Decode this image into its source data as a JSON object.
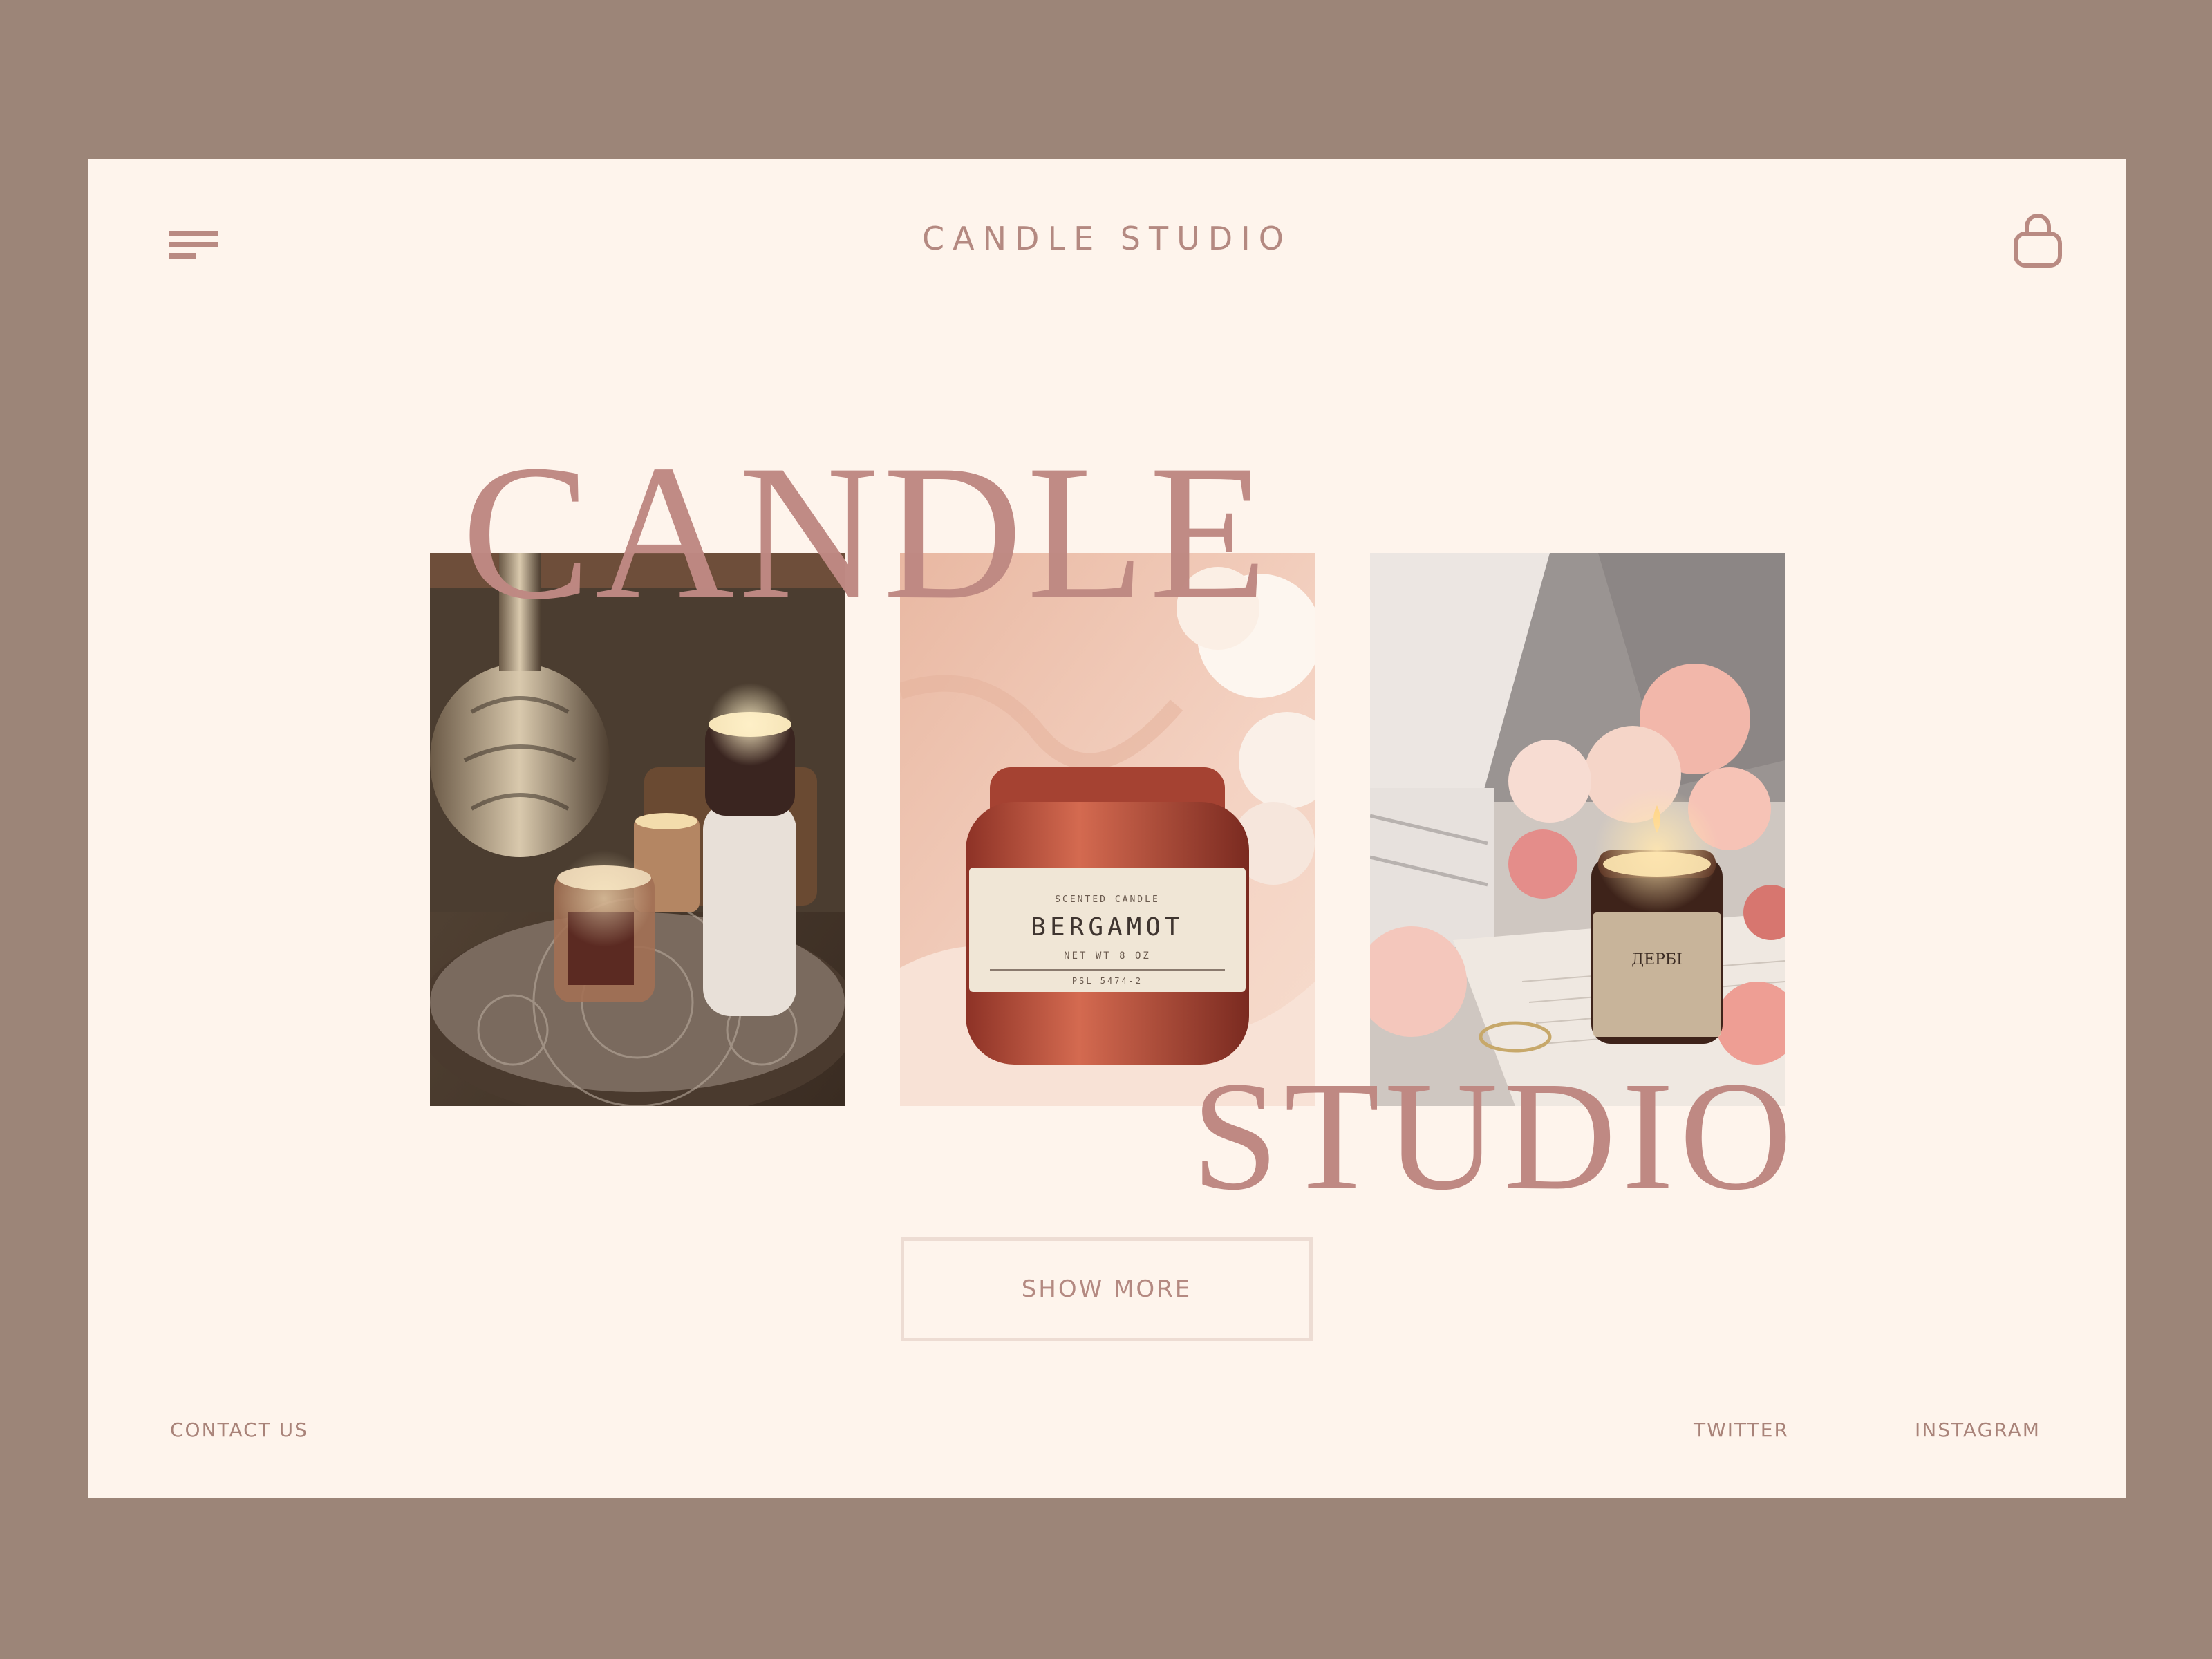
{
  "header": {
    "brand": "CANDLE STUDIO",
    "menu_icon": "menu-icon",
    "bag_icon": "shopping-bag-icon"
  },
  "hero": {
    "title_top": "CANDLE",
    "title_bottom": "STUDIO",
    "photos": [
      {
        "name": "candles-on-tray-photo"
      },
      {
        "name": "bergamot-candle-jar-photo",
        "label_top": "SCENTED CANDLE",
        "label_main": "BERGAMOT",
        "label_sub": "NET WT 8 OZ",
        "label_code": "PSL 5474-2"
      },
      {
        "name": "candle-with-flowers-photo",
        "label_main": "ДЕРБІ"
      }
    ],
    "show_more_label": "SHOW MORE"
  },
  "footer": {
    "contact_label": "CONTACT US",
    "twitter_label": "TWITTER",
    "instagram_label": "INSTAGRAM"
  },
  "colors": {
    "page_bg": "#9c8578",
    "frame_bg": "#fef4ec",
    "accent": "#bf8983",
    "text": "#b48981"
  }
}
